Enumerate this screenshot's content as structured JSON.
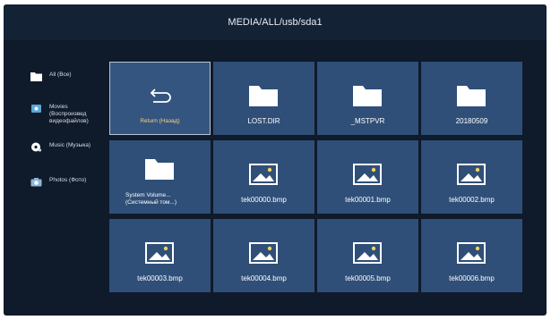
{
  "header": {
    "path": "MEDIA/ALL/usb/sda1"
  },
  "sidebar": {
    "items": [
      {
        "label": "All (Все)",
        "icon": "folder-icon"
      },
      {
        "label_lines": [
          "Movies",
          "(Воспроизвед",
          "видеофайлов)"
        ],
        "icon": "movie-icon"
      },
      {
        "label": "Music (Музыка)",
        "icon": "music-icon"
      },
      {
        "label": "Photos (Фото)",
        "icon": "camera-icon"
      }
    ]
  },
  "grid": {
    "tiles": [
      {
        "label": "Return (Назад)",
        "icon": "return-icon",
        "selected": true
      },
      {
        "label": "LOST.DIR",
        "icon": "folder-icon"
      },
      {
        "label": "_MSTPVR",
        "icon": "folder-icon"
      },
      {
        "label": "20180509",
        "icon": "folder-icon"
      },
      {
        "label_lines": [
          "System Volume...",
          "(Системный том...)"
        ],
        "icon": "folder-icon"
      },
      {
        "label": "tek00000.bmp",
        "icon": "image-file-icon"
      },
      {
        "label": "tek00001.bmp",
        "icon": "image-file-icon"
      },
      {
        "label": "tek00002.bmp",
        "icon": "image-file-icon"
      },
      {
        "label": "tek00003.bmp",
        "icon": "image-file-icon"
      },
      {
        "label": "tek00004.bmp",
        "icon": "image-file-icon"
      },
      {
        "label": "tek00005.bmp",
        "icon": "image-file-icon"
      },
      {
        "label": "tek00006.bmp",
        "icon": "image-file-icon"
      }
    ]
  },
  "colors": {
    "background": "#0f1a2a",
    "tile": "#2f4f78",
    "header": "#142236"
  }
}
